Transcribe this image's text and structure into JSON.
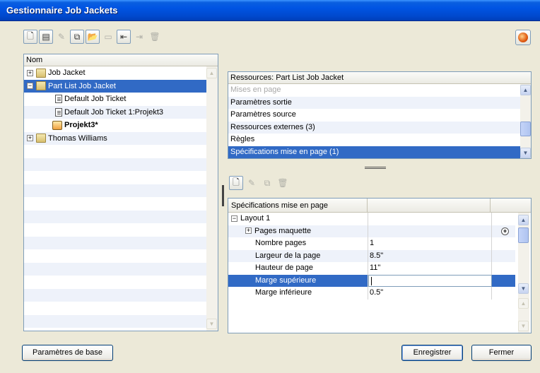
{
  "window": {
    "title": "Gestionnaire Job Jackets"
  },
  "toolbar_top": {
    "buttons": [
      "new-job-jacket-icon",
      "new-job-ticket-icon",
      "edit-icon",
      "duplicate-icon",
      "open-icon",
      "open-disabled-icon",
      "import-icon",
      "export-icon",
      "delete-icon"
    ]
  },
  "tree": {
    "header": "Nom",
    "items": [
      {
        "label": "Job Jacket",
        "expander": "+"
      },
      {
        "label": "Part List Job Jacket",
        "expander": "−"
      },
      {
        "label": "Default Job Ticket"
      },
      {
        "label": "Default Job Ticket 1:Projekt3"
      },
      {
        "label": "Projekt3*"
      },
      {
        "label": "Thomas Williams",
        "expander": "+"
      }
    ]
  },
  "resources": {
    "header": "Ressources: Part List Job Jacket",
    "items": [
      "Mises en page",
      "Paramètres sortie",
      "Paramètres source",
      "Ressources externes (3)",
      "Règles",
      "Spécifications mise en page (1)"
    ]
  },
  "spec": {
    "header": "Spécifications mise en page",
    "rows": [
      {
        "label": "Layout 1",
        "value": "",
        "expander": "−"
      },
      {
        "label": "Pages maquette",
        "value": "",
        "expander": "+"
      },
      {
        "label": "Nombre pages",
        "value": "1"
      },
      {
        "label": "Largeur de la page",
        "value": "8.5\""
      },
      {
        "label": "Hauteur de page",
        "value": "11\""
      },
      {
        "label": "Marge supérieure",
        "value": ""
      },
      {
        "label": "Marge inférieure",
        "value": "0.5\""
      }
    ]
  },
  "buttons": {
    "base_settings": "Paramètres de base",
    "save": "Enregistrer",
    "close": "Fermer"
  }
}
